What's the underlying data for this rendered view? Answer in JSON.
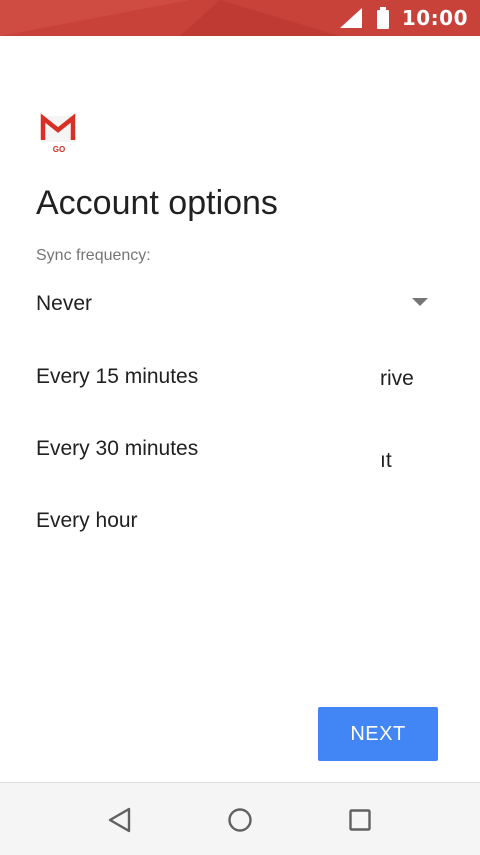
{
  "status_bar": {
    "time": "10:00",
    "colors": {
      "background": "#c8423a"
    },
    "icons": [
      "signal-icon",
      "battery-icon"
    ]
  },
  "app": {
    "logo_icon": "gmail-go-logo-icon",
    "logo_text": "GO"
  },
  "page": {
    "title": "Account options",
    "sync_label": "Sync frequency:"
  },
  "dropdown": {
    "selected": "Never",
    "options": [
      "Every 15 minutes",
      "Every 30 minutes",
      "Every hour"
    ]
  },
  "background_content": {
    "partial_text_1": "rive",
    "partial_text_2": "ıt"
  },
  "actions": {
    "next_label": "NEXT",
    "accent_color": "#4285f4"
  },
  "nav_bar": {
    "icons": [
      "back-icon",
      "home-icon",
      "recents-icon"
    ]
  }
}
